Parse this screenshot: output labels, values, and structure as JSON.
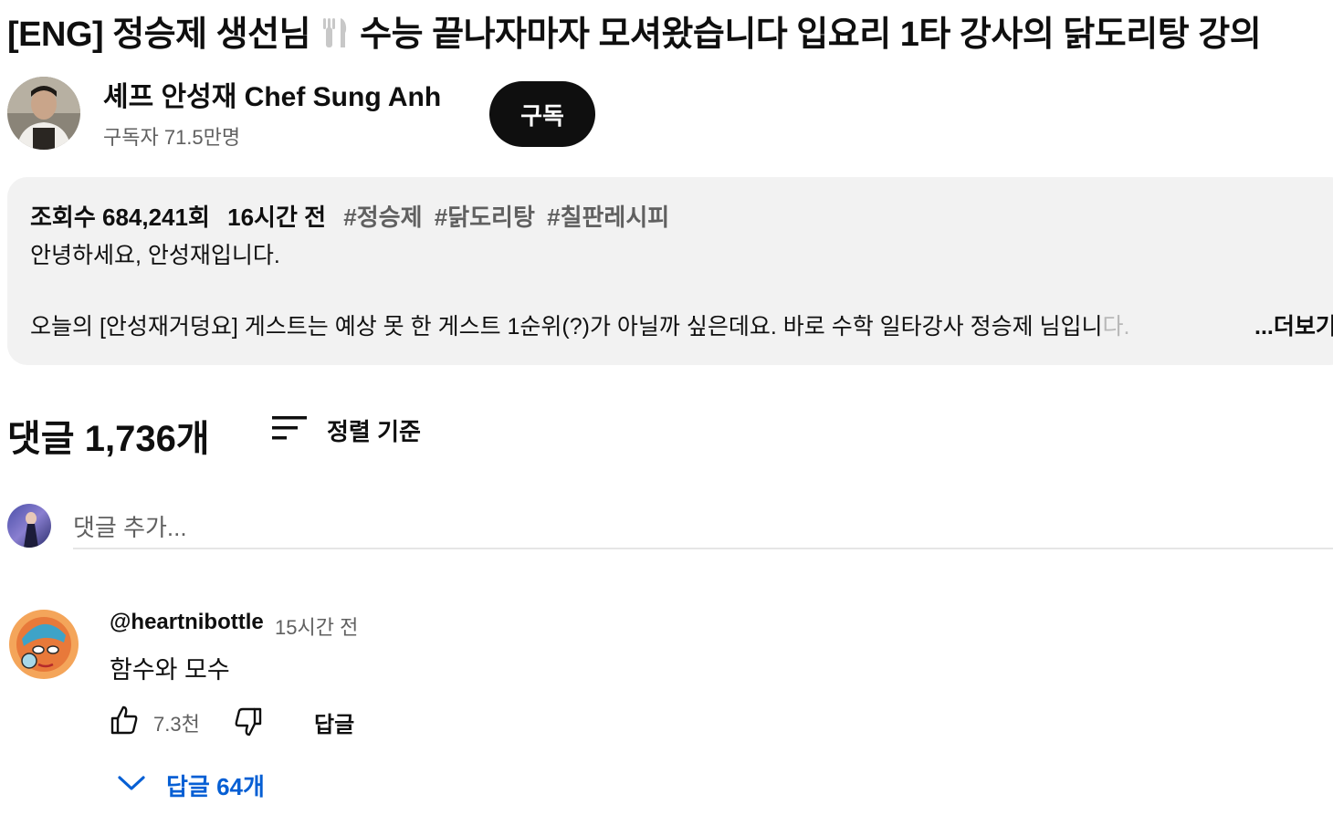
{
  "video": {
    "title_part1": "[ENG] 정승제 생선님",
    "title_part2": "수능 끝나자마자 모셔왔습니다 입요리 1타 강사의 닭도리탕 강의"
  },
  "channel": {
    "name": "셰프 안성재 Chef Sung Anh",
    "subscribers": "구독자 71.5만명",
    "subscribe_label": "구독"
  },
  "description": {
    "views": "조회수 684,241회",
    "time": "16시간 전",
    "hashtags": [
      "#정승제",
      "#닭도리탕",
      "#칠판레시피"
    ],
    "line1": "안녕하세요, 안성재입니다.",
    "line2_main": "오늘의 [안성재거덩요] 게스트는 예상 못 한 게스트 1순위(?)가 아닐까 싶은데요. 바로 수학 일타강사 정승제 님입니",
    "line2_fade": "다.",
    "more_label": "...더보기"
  },
  "comments": {
    "count_label": "댓글 1,736개",
    "sort_label": "정렬 기준",
    "add_placeholder": "댓글 추가...",
    "items": [
      {
        "author": "@heartnibottle",
        "time": "15시간 전",
        "text": "함수와 모수",
        "likes": "7.3천",
        "reply_label": "답글",
        "replies_label": "답글 64개"
      }
    ]
  },
  "icons": {
    "fork_knife": "fork-knife-icon",
    "sort": "sort-icon",
    "like": "thumbs-up-icon",
    "dislike": "thumbs-down-icon",
    "expand": "chevron-down-icon"
  },
  "colors": {
    "link_blue": "#065fd4",
    "subscribe_bg": "#0f0f0f",
    "description_bg": "#f2f2f2",
    "secondary_text": "#606060"
  }
}
